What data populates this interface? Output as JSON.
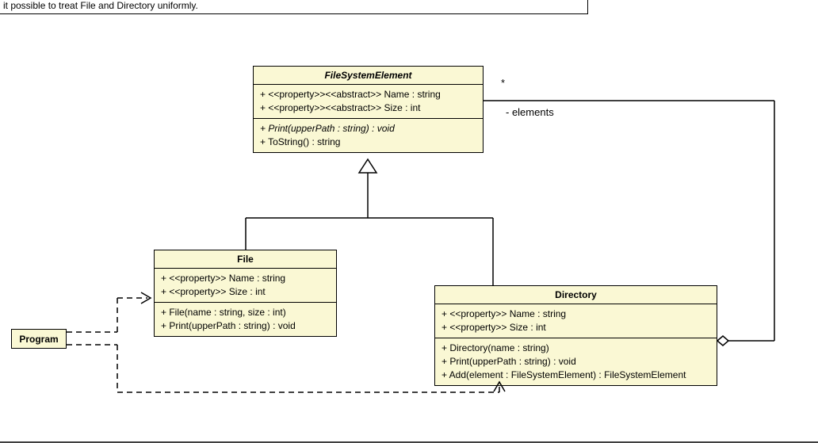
{
  "note": "it possible to treat File and Directory uniformly.",
  "assoc": {
    "mult": "*",
    "role": "- elements"
  },
  "program": {
    "name": "Program"
  },
  "fse": {
    "name": "FileSystemElement",
    "attr1": "+ <<property>><<abstract>> Name : string",
    "attr2": "+ <<property>><<abstract>> Size : int",
    "op1": "+ Print(upperPath : string) : void",
    "op2": "+ ToString() : string"
  },
  "file": {
    "name": "File",
    "attr1": "+ <<property>> Name : string",
    "attr2": "+ <<property>> Size : int",
    "op1": "+ File(name : string, size : int)",
    "op2": "+ Print(upperPath : string) : void"
  },
  "dir": {
    "name": "Directory",
    "attr1": "+ <<property>> Name : string",
    "attr2": "+ <<property>> Size : int",
    "op1": "+ Directory(name : string)",
    "op2": "+ Print(upperPath : string) : void",
    "op3": "+ Add(element : FileSystemElement) : FileSystemElement"
  }
}
